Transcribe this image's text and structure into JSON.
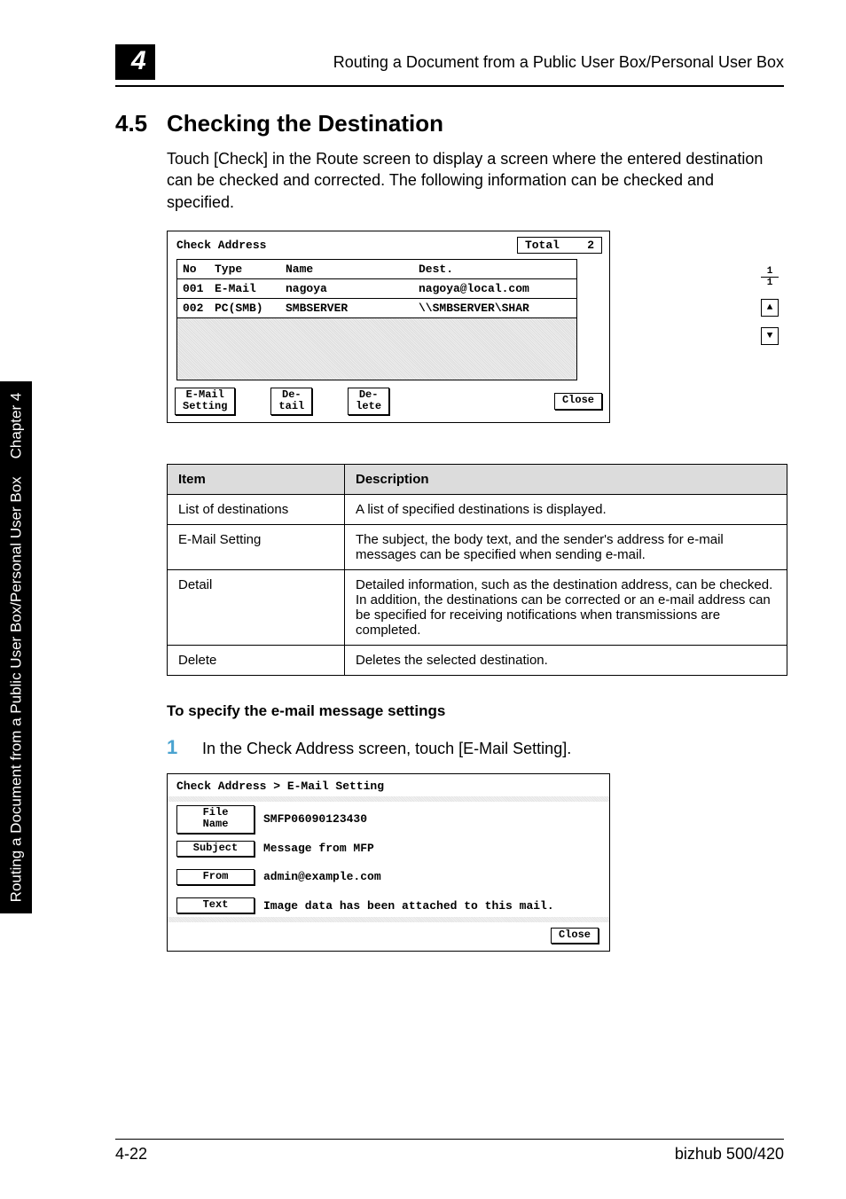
{
  "header": {
    "chapter_number": "4",
    "running_head": "Routing a Document from a Public User Box/Personal User Box"
  },
  "section": {
    "number": "4.5",
    "title": "Checking the Destination",
    "intro": "Touch [Check] in the Route screen to display a screen where the entered destination can be checked and corrected. The following information can be checked and specified."
  },
  "check_screen": {
    "title": "Check Address",
    "total_label": "Total",
    "total_value": "2",
    "cols": {
      "no": "No",
      "type": "Type",
      "name": "Name",
      "dest": "Dest."
    },
    "rows": [
      {
        "no": "001",
        "type": "E-Mail",
        "name": "nagoya",
        "dest": "nagoya@local.com"
      },
      {
        "no": "002",
        "type": "PC(SMB)",
        "name": "SMBSERVER",
        "dest": "\\\\SMBSERVER\\SHAR"
      }
    ],
    "page": {
      "current": "1",
      "total": "1"
    },
    "buttons": {
      "email_setting": "E-Mail\nSetting",
      "detail": "De-\ntail",
      "delete": "De-\nlete",
      "close": "Close"
    }
  },
  "table": {
    "head_item": "Item",
    "head_desc": "Description",
    "rows": [
      {
        "item": "List of destinations",
        "desc": "A list of specified destinations is displayed."
      },
      {
        "item": "E-Mail Setting",
        "desc": "The subject, the body text, and the sender's address for e-mail messages can be specified when sending e-mail."
      },
      {
        "item": "Detail",
        "desc": "Detailed information, such as the destination address, can be checked. In addition, the destinations can be corrected or an e-mail address can be specified for receiving notifications when transmissions are completed."
      },
      {
        "item": "Delete",
        "desc": "Deletes the selected destination."
      }
    ]
  },
  "subhead": "To specify the e-mail message settings",
  "step1": {
    "num": "1",
    "text": "In the Check Address screen, touch [E-Mail Setting]."
  },
  "email_screen": {
    "title": "Check Address > E-Mail Setting",
    "file_name_label": "File\nName",
    "file_name_value": "SMFP06090123430",
    "subject_label": "Subject",
    "subject_value": "Message from MFP",
    "from_label": "From",
    "from_value": "admin@example.com",
    "text_label": "Text",
    "text_value": "Image data has been attached to this mail.",
    "close": "Close"
  },
  "side_tab": {
    "title": "Routing a Document from a Public User Box/Personal User Box",
    "chapter": "Chapter 4"
  },
  "footer": {
    "page": "4-22",
    "model": "bizhub 500/420"
  }
}
